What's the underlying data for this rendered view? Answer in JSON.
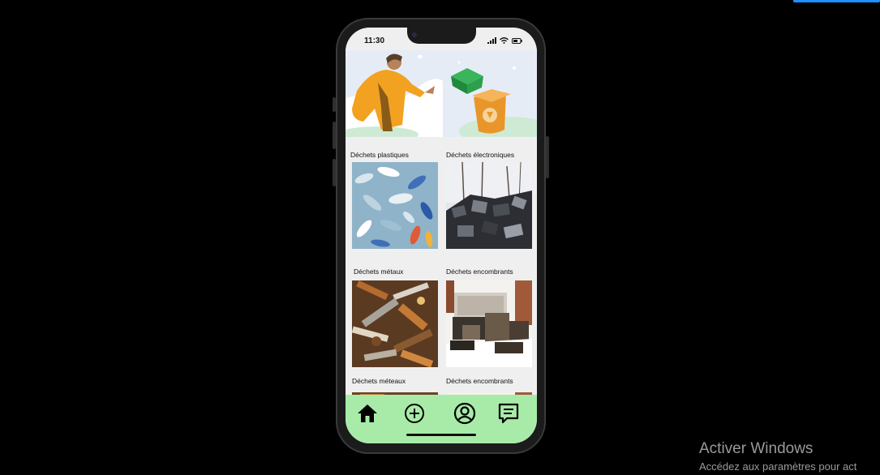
{
  "status_bar": {
    "time": "11:30"
  },
  "categories": [
    {
      "label": "Déchets plastiques"
    },
    {
      "label": "Déchets électroniques"
    },
    {
      "label": "Déchets métaux"
    },
    {
      "label": "Déchets encombrants"
    },
    {
      "label": "Déchets méteaux"
    },
    {
      "label": "Déchets encombrants"
    }
  ],
  "bottom_nav": {
    "items": [
      {
        "icon": "home-icon"
      },
      {
        "icon": "add-circle-icon"
      },
      {
        "icon": "account-icon"
      },
      {
        "icon": "message-icon"
      }
    ],
    "color": "#a8eba8"
  },
  "watermark": {
    "title": "Activer Windows",
    "subtitle": "Accédez aux paramètres pour act"
  },
  "colors": {
    "accent": "#1e90ff",
    "screen_bg": "#efefef"
  }
}
